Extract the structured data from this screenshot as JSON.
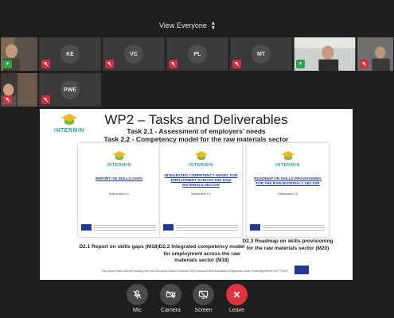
{
  "top_bar": {
    "view_label": "View Everyone"
  },
  "participants": {
    "ke": "KE",
    "vc": "VC",
    "pl": "PL",
    "mt": "MT",
    "pwe": "PWE"
  },
  "slide": {
    "title": "WP2 – Tasks and Deliverables",
    "task1": "Task 2.1 - Assessment of employers’ needs",
    "task2": "Task 2.2 - Competency model for the raw materials sector",
    "brand": "INTERMIN",
    "docs": [
      {
        "title": "REPORT ON SKILLS GAPS",
        "deliverable": "Deliverable 2.1",
        "caption": "D2.1 Report on skills gaps (M18)"
      },
      {
        "title": "INTEGRATED COMPETENCY MODEL FOR EMPLOYMENT ACROSS THE RAW MATERIALS SECTOR",
        "deliverable": "Deliverable 2.2",
        "caption": "D2.2 Integrated competency model for employment across the raw materials sector (M18)"
      },
      {
        "title": "ROADMAP ON SKILLS PROVISIONING FOR THE RAW MATERIALS SECTOR",
        "deliverable": "Deliverable 2.3",
        "caption": "D2.3 Roadmap on skills provisioning for the raw materials sector (M20)"
      }
    ],
    "footer": "This project has received funding from the European Union's Horizon 2020 research and innovation programme under Grant Agreement No 776642."
  },
  "controls": {
    "mic": "Mic",
    "camera": "Camera",
    "screen": "Screen",
    "leave": "Leave"
  },
  "colors": {
    "background": "#1f1f1f",
    "tile": "#3a3a3a",
    "muted_red": "#d0303b",
    "leave_red": "#e0333f",
    "brand_teal": "#2a9bb0",
    "doc_title_blue": "#1d3f8f"
  }
}
